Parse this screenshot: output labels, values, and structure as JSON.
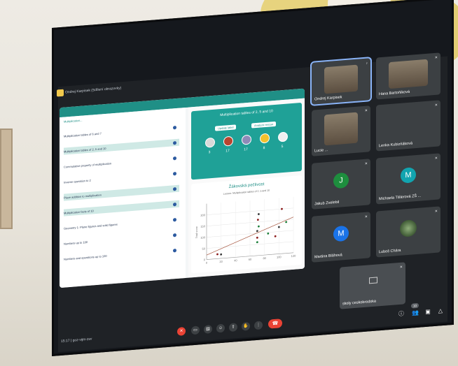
{
  "meet": {
    "title": "Ondrej Karpisek (Sdílení obrazovky)",
    "time_and_code": "15:17 | goz-vijm-zsv"
  },
  "share": {
    "sidebar_heading": "Multiplication...",
    "lessons": [
      {
        "label": "Multiplication tables of 6 and 7",
        "highlight": false
      },
      {
        "label": "Multiplication tables of 2, 5 and 10",
        "highlight": true
      },
      {
        "label": "Commutative property of multiplication",
        "highlight": false
      },
      {
        "label": "Inverse operation to 2",
        "highlight": false
      },
      {
        "label": "Place addition to multiplication",
        "highlight": true
      },
      {
        "label": "Multiplication facts of 10",
        "highlight": true
      },
      {
        "label": "Geometry 1: Plane figures and solid figures",
        "highlight": false
      },
      {
        "label": "Numbers up to 100",
        "highlight": false
      },
      {
        "label": "Numbers and operations up to 100",
        "highlight": false
      }
    ],
    "card_title": "Multiplication tables of 2, 5 and 10",
    "card_buttons": [
      "Update label",
      "Analyze rescue"
    ],
    "medal_counts": [
      "3",
      "17",
      "17",
      "8",
      "5"
    ],
    "medal_colors": [
      "#d9d9d9",
      "#b9442f",
      "#8f8ab8",
      "#f2c12e",
      "#f0f0f0"
    ],
    "chart_title": "Žákovská pečlivost",
    "chart_subtitle": "Lesson: Multiplication tables of 2, 5 and 10"
  },
  "participants": [
    {
      "name": "Ondrej Karpisek",
      "kind": "video",
      "speaking": true
    },
    {
      "name": "Hana Bartoňíková",
      "kind": "video"
    },
    {
      "name": "Lucie ...",
      "kind": "video"
    },
    {
      "name": "Lenka Kubizňáková",
      "kind": "blank"
    },
    {
      "name": "Jakub Zvelebil",
      "kind": "avatar",
      "initial": "J",
      "color": "#1e8e3e"
    },
    {
      "name": "Michaela Tišlerová ZŠ ...",
      "kind": "avatar",
      "initial": "M",
      "color": "#12a4af"
    },
    {
      "name": "Martina Bláhová",
      "kind": "avatar",
      "initial": "M",
      "color": "#1a73e8"
    },
    {
      "name": "Luboš Chára",
      "kind": "photo"
    },
    {
      "name": "skoly ceskobrodska",
      "kind": "self"
    }
  ],
  "people_count": "10",
  "chart_data": {
    "type": "scatter",
    "title": "Žákovská pečlivost",
    "subtitle": "Lesson: Multiplication tables of 2, 5 and 10",
    "xlabel": "",
    "ylabel": "Total score",
    "xlim": [
      0,
      120
    ],
    "ylim": [
      0,
      250
    ],
    "x_ticks": [
      "0",
      "20",
      "40",
      "60",
      "80",
      "100",
      "120"
    ],
    "y_ticks": [
      "0",
      "50",
      "100",
      "150",
      "200"
    ],
    "points": [
      {
        "x": 15,
        "y": 20
      },
      {
        "x": 20,
        "y": 18
      },
      {
        "x": 70,
        "y": 60
      },
      {
        "x": 70,
        "y": 80
      },
      {
        "x": 70,
        "y": 110
      },
      {
        "x": 72,
        "y": 130
      },
      {
        "x": 71,
        "y": 160
      },
      {
        "x": 72,
        "y": 185
      },
      {
        "x": 85,
        "y": 95
      },
      {
        "x": 95,
        "y": 80
      },
      {
        "x": 100,
        "y": 120
      },
      {
        "x": 110,
        "y": 140
      },
      {
        "x": 104,
        "y": 200
      }
    ],
    "trend": [
      [
        0,
        20
      ],
      [
        120,
        160
      ]
    ],
    "grid": true
  }
}
